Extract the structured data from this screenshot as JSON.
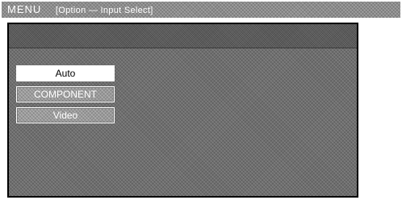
{
  "title_bar": {
    "menu_label": "MENU",
    "path_label": "[Option — Input Select]"
  },
  "options": [
    {
      "label": "Auto",
      "selected": true
    },
    {
      "label": "COMPONENT",
      "selected": false
    },
    {
      "label": "Video",
      "selected": false
    }
  ],
  "colors": {
    "title_bar": "#8c8c8c",
    "panel": "#6e6e6e",
    "selected_option_bg": "#ffffff",
    "unselected_option_bg": "#9a9a9a"
  }
}
